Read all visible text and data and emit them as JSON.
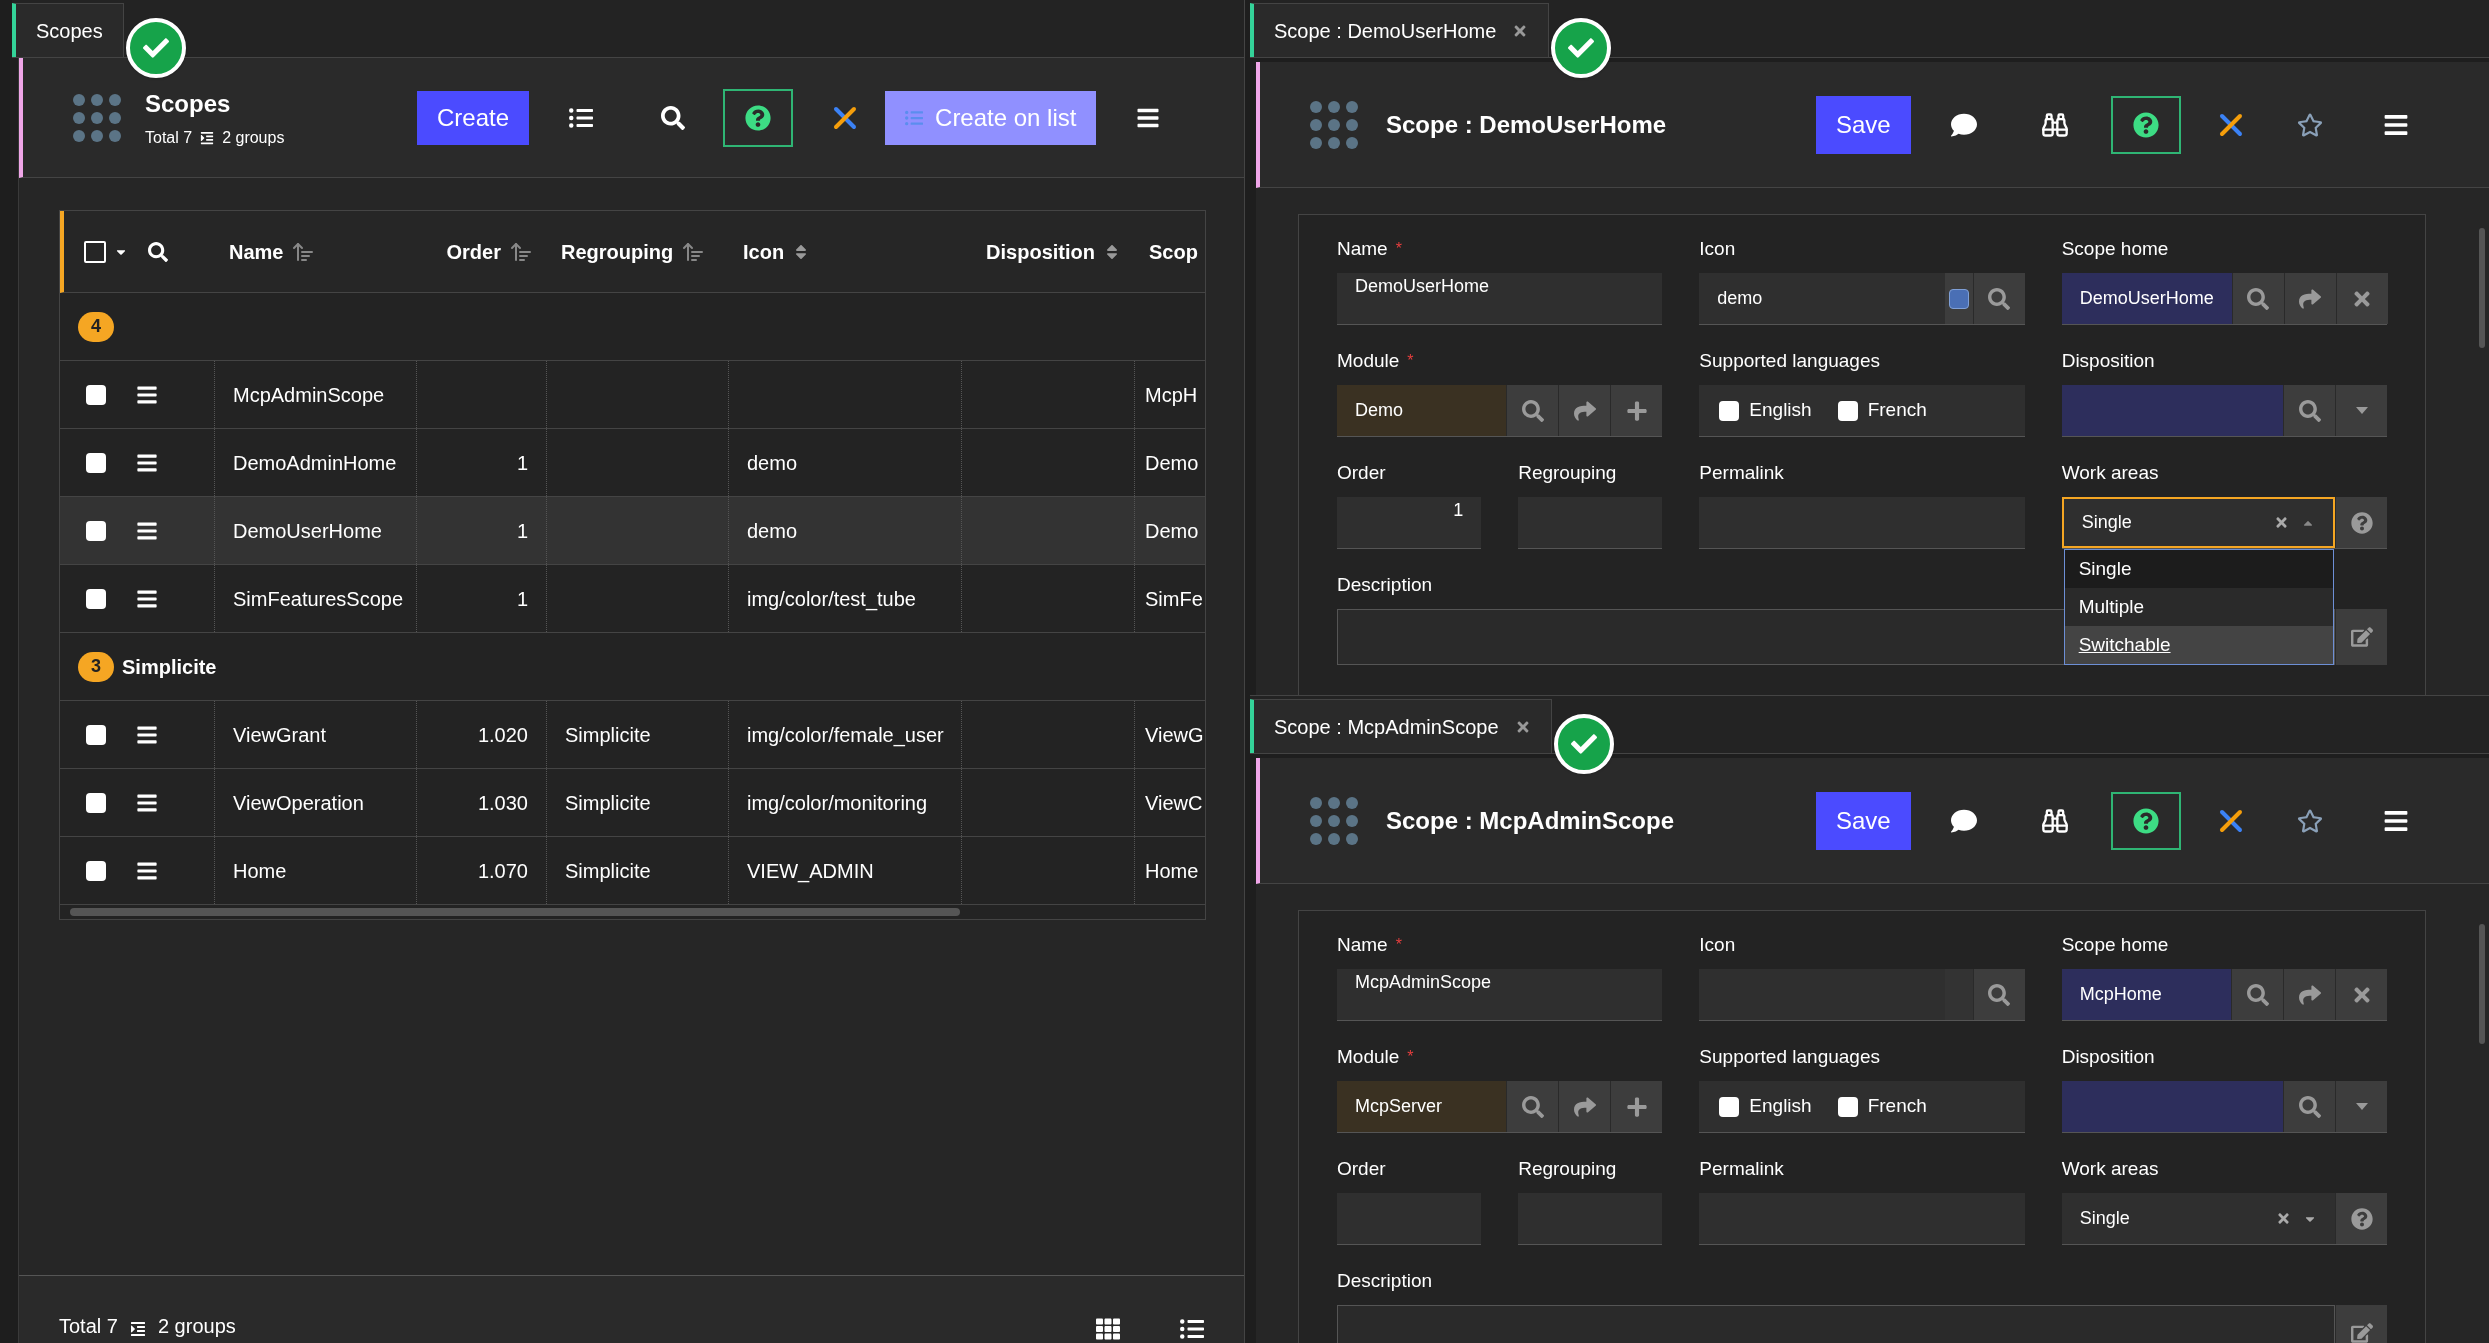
{
  "list_panel": {
    "tab": {
      "label": "Scopes",
      "closable": false
    },
    "title": "Scopes",
    "total": "Total 7",
    "groups_count": "2 groups",
    "create_button": "Create",
    "create_on_list_button": "Create on list",
    "table": {
      "select_all_checked": false,
      "columns": [
        {
          "label": "Name",
          "sorted": true
        },
        {
          "label": "Order",
          "sorted": true
        },
        {
          "label": "Regrouping",
          "sorted": true
        },
        {
          "label": "Icon",
          "sorted": false
        },
        {
          "label": "Disposition",
          "sorted": false
        },
        {
          "label": "Scop"
        }
      ],
      "groups": [
        {
          "count": "4",
          "rows": [
            {
              "checked": false,
              "highlighted": false,
              "cells": {
                "name": "McpAdminScope",
                "scope": "McpH"
              }
            },
            {
              "checked": false,
              "highlighted": false,
              "cells": {
                "name": "DemoAdminHome",
                "order": "1",
                "icon": "demo",
                "scope": "Demo"
              }
            },
            {
              "checked": false,
              "highlighted": true,
              "cells": {
                "name": "DemoUserHome",
                "order": "1",
                "icon": "demo",
                "scope": "Demo"
              }
            },
            {
              "checked": false,
              "highlighted": false,
              "cells": {
                "name": "SimFeaturesScope",
                "order": "1",
                "icon": "img/color/test_tube",
                "scope": "SimFe"
              }
            }
          ]
        },
        {
          "count": "3",
          "label": "Simplicite",
          "rows": [
            {
              "checked": false,
              "highlighted": false,
              "cells": {
                "name": "ViewGrant",
                "order": "1.020",
                "regrouping": "Simplicite",
                "icon": "img/color/female_user",
                "scope": "ViewG"
              }
            },
            {
              "checked": false,
              "highlighted": false,
              "cells": {
                "name": "ViewOperation",
                "order": "1.030",
                "regrouping": "Simplicite",
                "icon": "img/color/monitoring",
                "scope": "ViewC"
              }
            },
            {
              "checked": false,
              "highlighted": false,
              "cells": {
                "name": "Home",
                "order": "1.070",
                "regrouping": "Simplicite",
                "icon": "VIEW_ADMIN",
                "scope": "Home"
              }
            }
          ]
        }
      ]
    },
    "footer": {
      "total": "Total 7",
      "groups_count": "2 groups"
    }
  },
  "forms": [
    {
      "tab": {
        "label": "Scope : DemoUserHome",
        "closable": true
      },
      "title": "Scope : DemoUserHome",
      "save_button": "Save",
      "fields": [
        {
          "kind": "text",
          "label": "Name",
          "required_mark": "*",
          "value": "DemoUserHome"
        },
        {
          "kind": "icon_lookup",
          "label": "Icon",
          "value": "demo",
          "preview": true
        },
        {
          "kind": "object_link",
          "label": "Scope home",
          "value": "DemoUserHome"
        },
        {
          "kind": "module_link",
          "label": "Module",
          "required_mark": "*",
          "value": "Demo"
        },
        {
          "kind": "checkboxes",
          "label": "Supported languages",
          "options": [
            {
              "label": "English",
              "checked": false
            },
            {
              "label": "French",
              "checked": false
            }
          ]
        },
        {
          "kind": "list_lookup",
          "label": "Disposition"
        },
        {
          "kind": "half",
          "label": "Order",
          "value": "1"
        },
        {
          "kind": "half",
          "label": "Regrouping"
        },
        {
          "kind": "text",
          "label": "Permalink"
        },
        {
          "kind": "select",
          "label": "Work areas",
          "value": "Single",
          "expanded": true,
          "options": [
            {
              "label": "Single",
              "selected": true,
              "hovered": false
            },
            {
              "label": "Multiple",
              "selected": false,
              "hovered": false
            },
            {
              "label": "Switchable",
              "selected": false,
              "hovered": true
            }
          ]
        },
        {
          "kind": "textarea",
          "label": "Description"
        }
      ]
    },
    {
      "tab": {
        "label": "Scope : McpAdminScope",
        "closable": true
      },
      "title": "Scope : McpAdminScope",
      "save_button": "Save",
      "fields": [
        {
          "kind": "text",
          "label": "Name",
          "required_mark": "*",
          "value": "McpAdminScope"
        },
        {
          "kind": "icon_lookup",
          "label": "Icon",
          "preview": false
        },
        {
          "kind": "object_link",
          "label": "Scope home",
          "value": "McpHome"
        },
        {
          "kind": "module_link",
          "label": "Module",
          "required_mark": "*",
          "value": "McpServer"
        },
        {
          "kind": "checkboxes",
          "label": "Supported languages",
          "options": [
            {
              "label": "English",
              "checked": false
            },
            {
              "label": "French",
              "checked": false
            }
          ]
        },
        {
          "kind": "list_lookup",
          "label": "Disposition"
        },
        {
          "kind": "half",
          "label": "Order"
        },
        {
          "kind": "half",
          "label": "Regrouping"
        },
        {
          "kind": "text",
          "label": "Permalink"
        },
        {
          "kind": "select",
          "label": "Work areas",
          "value": "Single",
          "expanded": false
        },
        {
          "kind": "textarea",
          "label": "Description"
        }
      ]
    }
  ]
}
